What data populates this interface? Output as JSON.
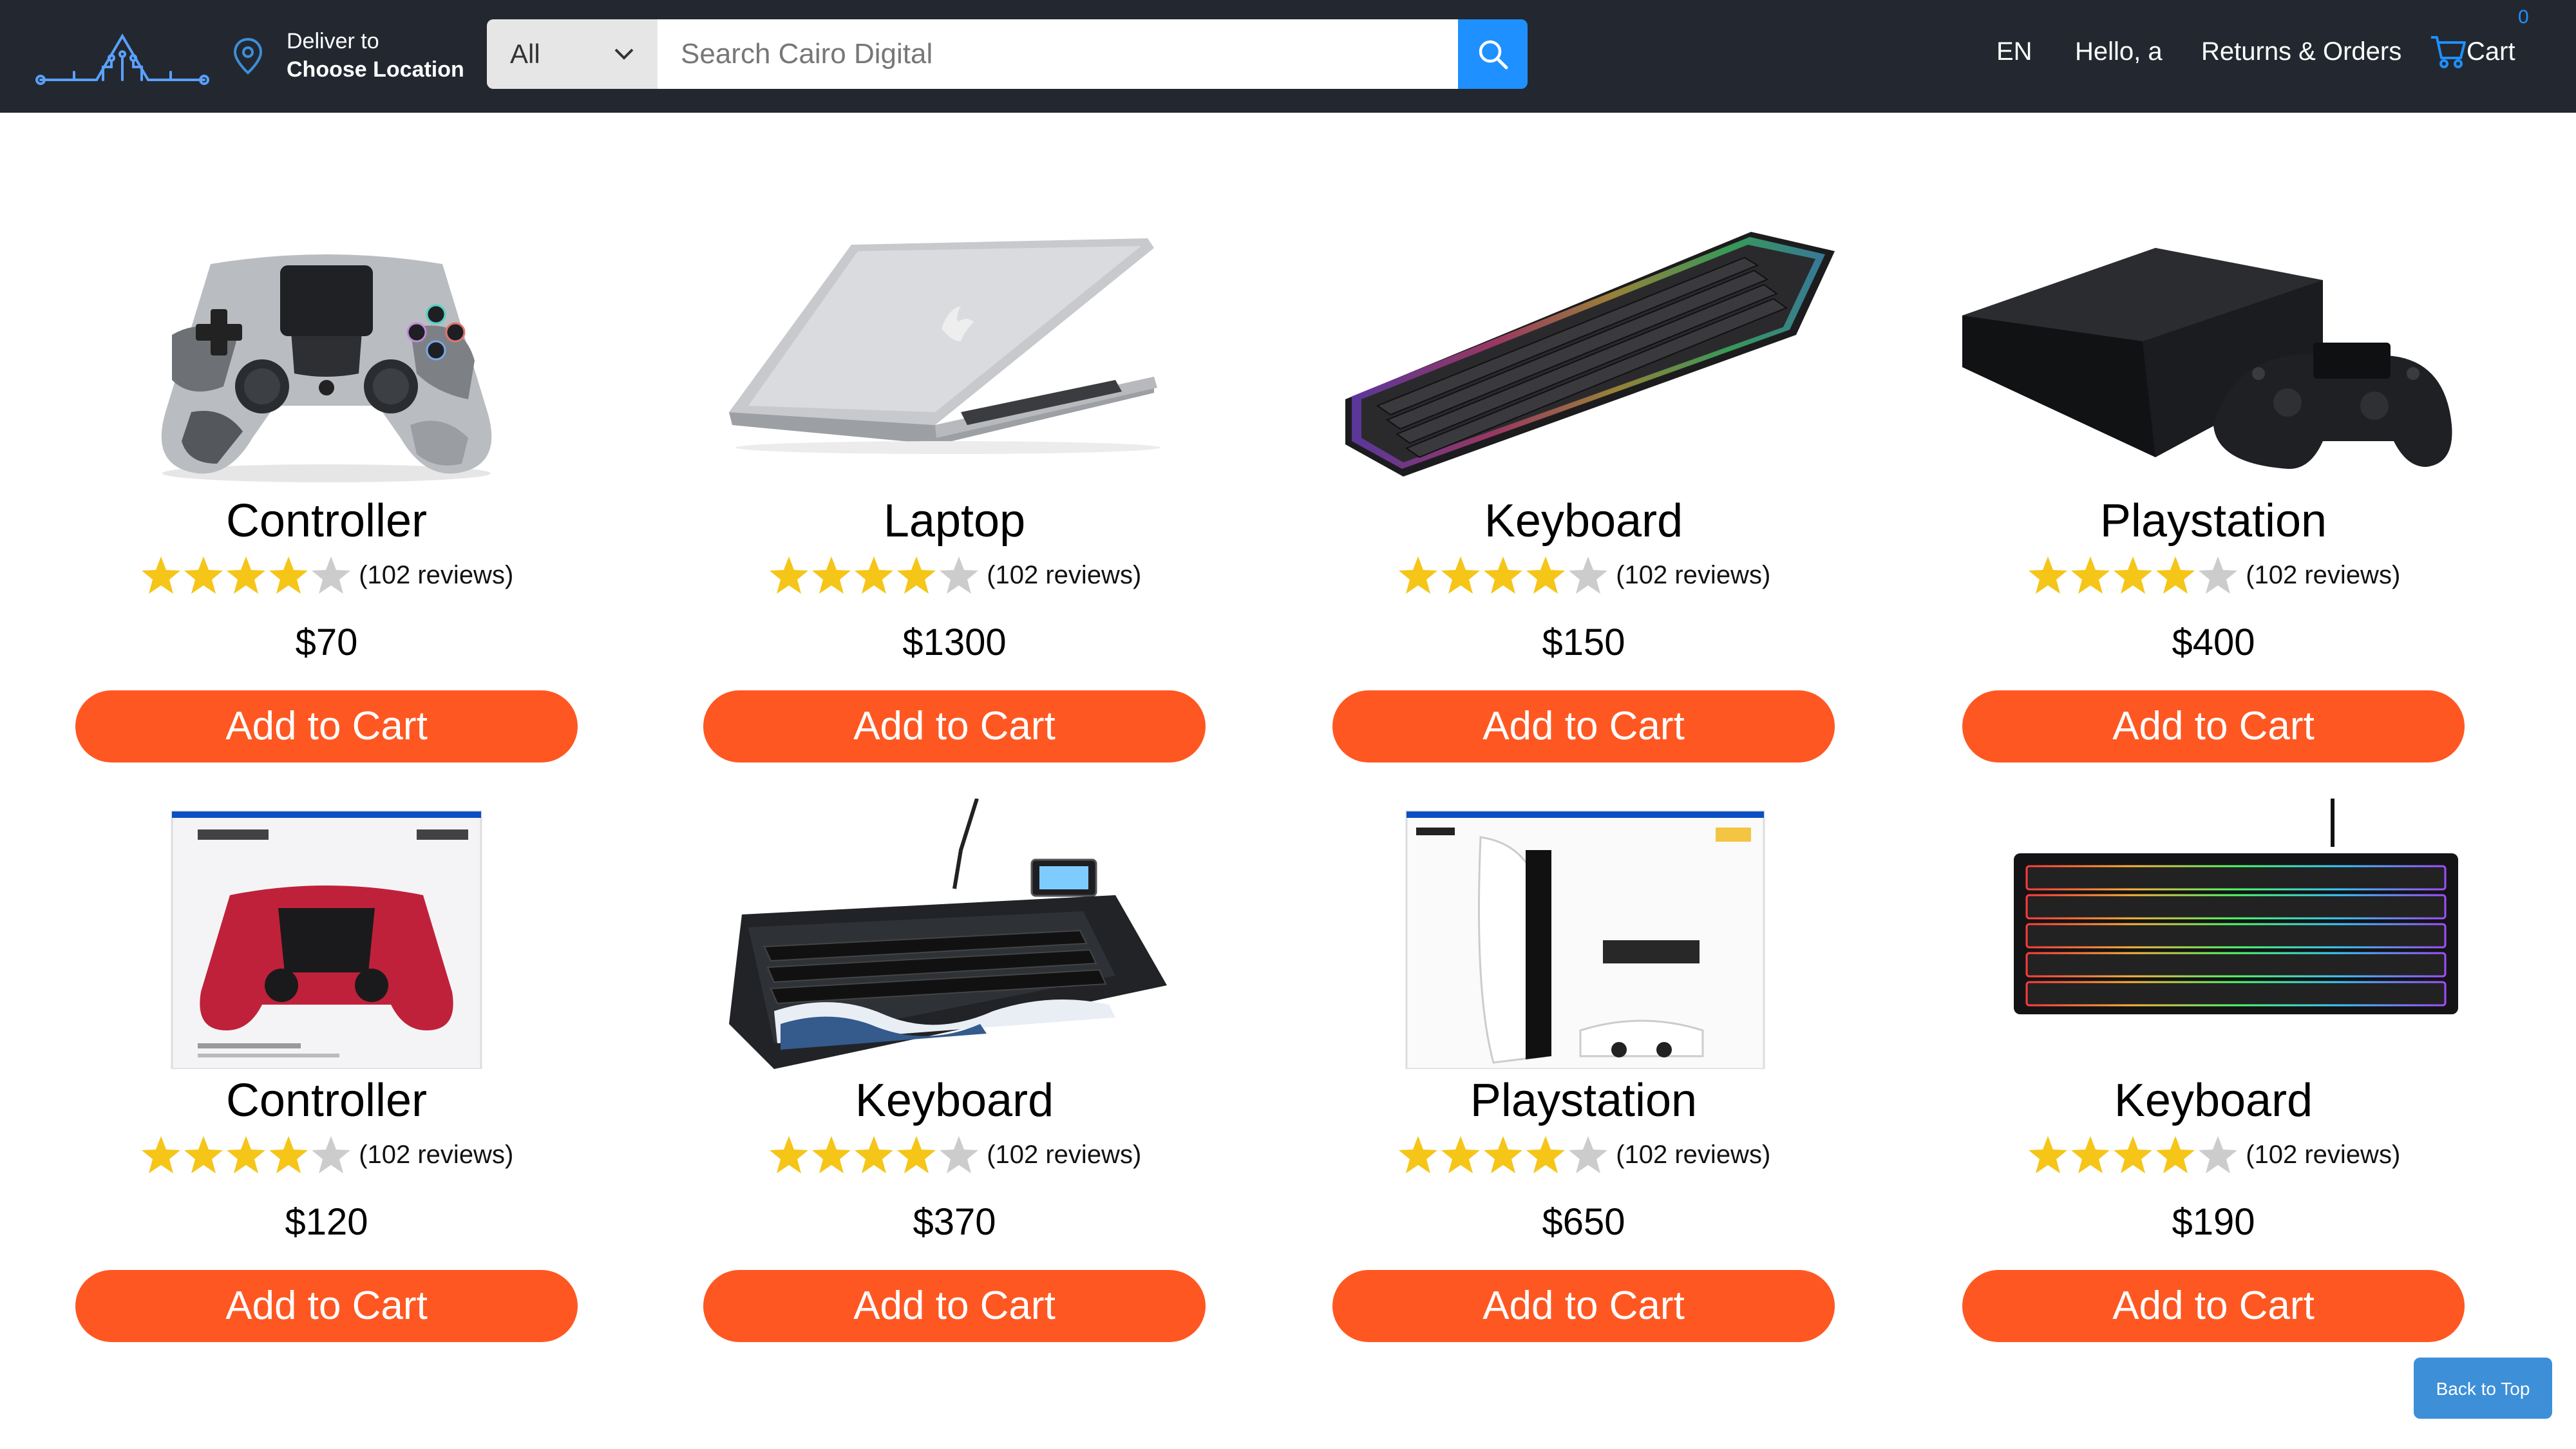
{
  "header": {
    "logo_icon": "circuit-logo-icon",
    "deliver_line1": "Deliver to",
    "deliver_line2": "Choose Location",
    "location_icon": "location-pin-icon",
    "search": {
      "category_selected": "All",
      "placeholder": "Search Cairo Digital",
      "value": "",
      "button_icon": "search-icon"
    },
    "nav": {
      "language": "EN",
      "greeting": "Hello, a",
      "returns_orders": "Returns & Orders",
      "cart_label": "Cart",
      "cart_count": "0",
      "cart_icon": "cart-icon"
    }
  },
  "products": [
    {
      "name": "Controller",
      "rating": 4,
      "reviews": "(102 reviews)",
      "price": "$70",
      "button": "Add to Cart",
      "image": "camo-controller-image"
    },
    {
      "name": "Laptop",
      "rating": 4,
      "reviews": "(102 reviews)",
      "price": "$1300",
      "button": "Add to Cart",
      "image": "laptop-image"
    },
    {
      "name": "Keyboard",
      "rating": 4,
      "reviews": "(102 reviews)",
      "price": "$150",
      "button": "Add to Cart",
      "image": "rgb-keyboard-image"
    },
    {
      "name": "Playstation",
      "rating": 4,
      "reviews": "(102 reviews)",
      "price": "$400",
      "button": "Add to Cart",
      "image": "ps4-console-image"
    },
    {
      "name": "Controller",
      "rating": 4,
      "reviews": "(102 reviews)",
      "price": "$120",
      "button": "Add to Cart",
      "image": "dualsense-box-image"
    },
    {
      "name": "Keyboard",
      "rating": 4,
      "reviews": "(102 reviews)",
      "price": "$370",
      "button": "Add to Cart",
      "image": "wave-keyboard-image"
    },
    {
      "name": "Playstation",
      "rating": 4,
      "reviews": "(102 reviews)",
      "price": "$650",
      "button": "Add to Cart",
      "image": "ps5-box-image"
    },
    {
      "name": "Keyboard",
      "rating": 4,
      "reviews": "(102 reviews)",
      "price": "$190",
      "button": "Add to Cart",
      "image": "tkl-keyboard-image"
    }
  ],
  "back_to_top": "Back to Top",
  "colors": {
    "header_bg": "#232830",
    "accent_blue": "#1e90ff",
    "button_orange": "#ff5722",
    "star_gold": "#f5c518",
    "star_empty": "#cccccc",
    "back_top_bg": "#3d8fd8"
  }
}
